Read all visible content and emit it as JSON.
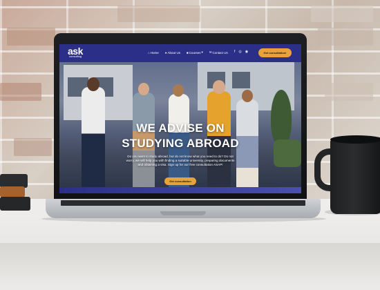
{
  "website": {
    "logo": {
      "name": "ask",
      "tagline": "consulting"
    },
    "nav": {
      "items": [
        {
          "label": "Home",
          "icon": "home-icon"
        },
        {
          "label": "About Us",
          "icon": "user-icon"
        },
        {
          "label": "Courses",
          "icon": "book-icon",
          "has_dropdown": true
        },
        {
          "label": "Contact Us",
          "icon": "mail-icon"
        }
      ],
      "social": [
        "f",
        "◎",
        "◉"
      ],
      "cta_label": "Get consultation!"
    },
    "hero": {
      "title_line1": "WE ADVISE ON",
      "title_line2": "STUDYING ABROAD",
      "body": "Do you want to study abroad, but do not know what you need to do? Do not worry, we will help you with finding a suitable university, preparing documents and obtaining a visa. Sign up for our free consultation ASAP!",
      "button_label": "Get consultation"
    }
  },
  "colors": {
    "nav_bg": "#2c2f88",
    "accent": "#e9a23b",
    "text_light": "#ffffff"
  }
}
